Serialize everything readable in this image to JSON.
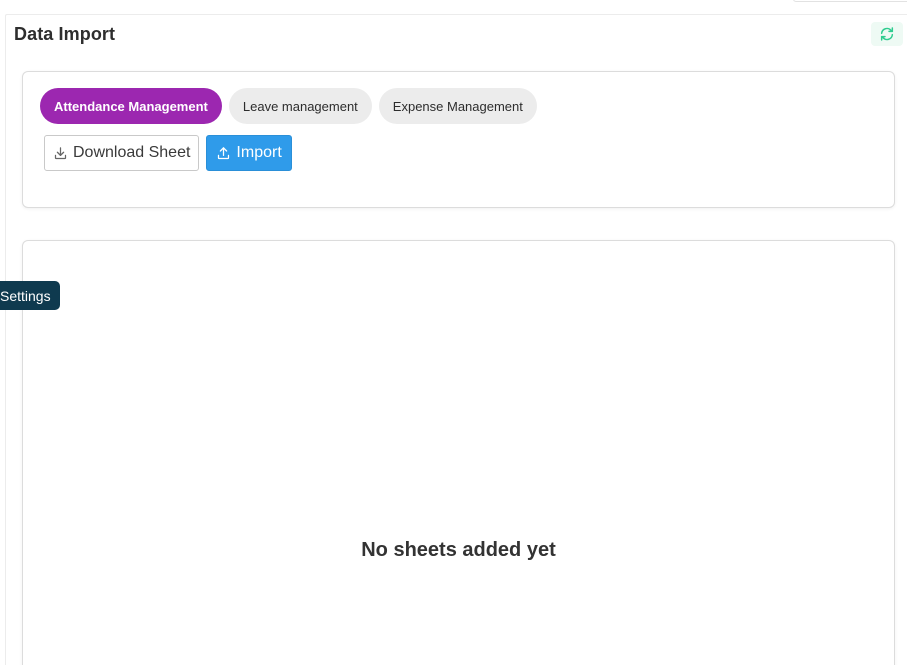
{
  "header": {
    "title": "Data Import",
    "refresh_icon": "refresh-icon"
  },
  "tabs": [
    {
      "label": "Attendance Management",
      "active": true
    },
    {
      "label": "Leave management",
      "active": false
    },
    {
      "label": "Expense Management",
      "active": false
    }
  ],
  "actions": {
    "download_label": "Download Sheet",
    "download_icon": "download-icon",
    "import_label": "Import",
    "import_icon": "upload-icon"
  },
  "empty_state": {
    "message": "No sheets added yet"
  },
  "side_tab": {
    "label": "Settings"
  },
  "colors": {
    "active_tab": "#9c27b0",
    "import_button": "#2f9bea",
    "refresh_icon": "#2ecc8f",
    "settings_tab": "#0f3a4f"
  }
}
